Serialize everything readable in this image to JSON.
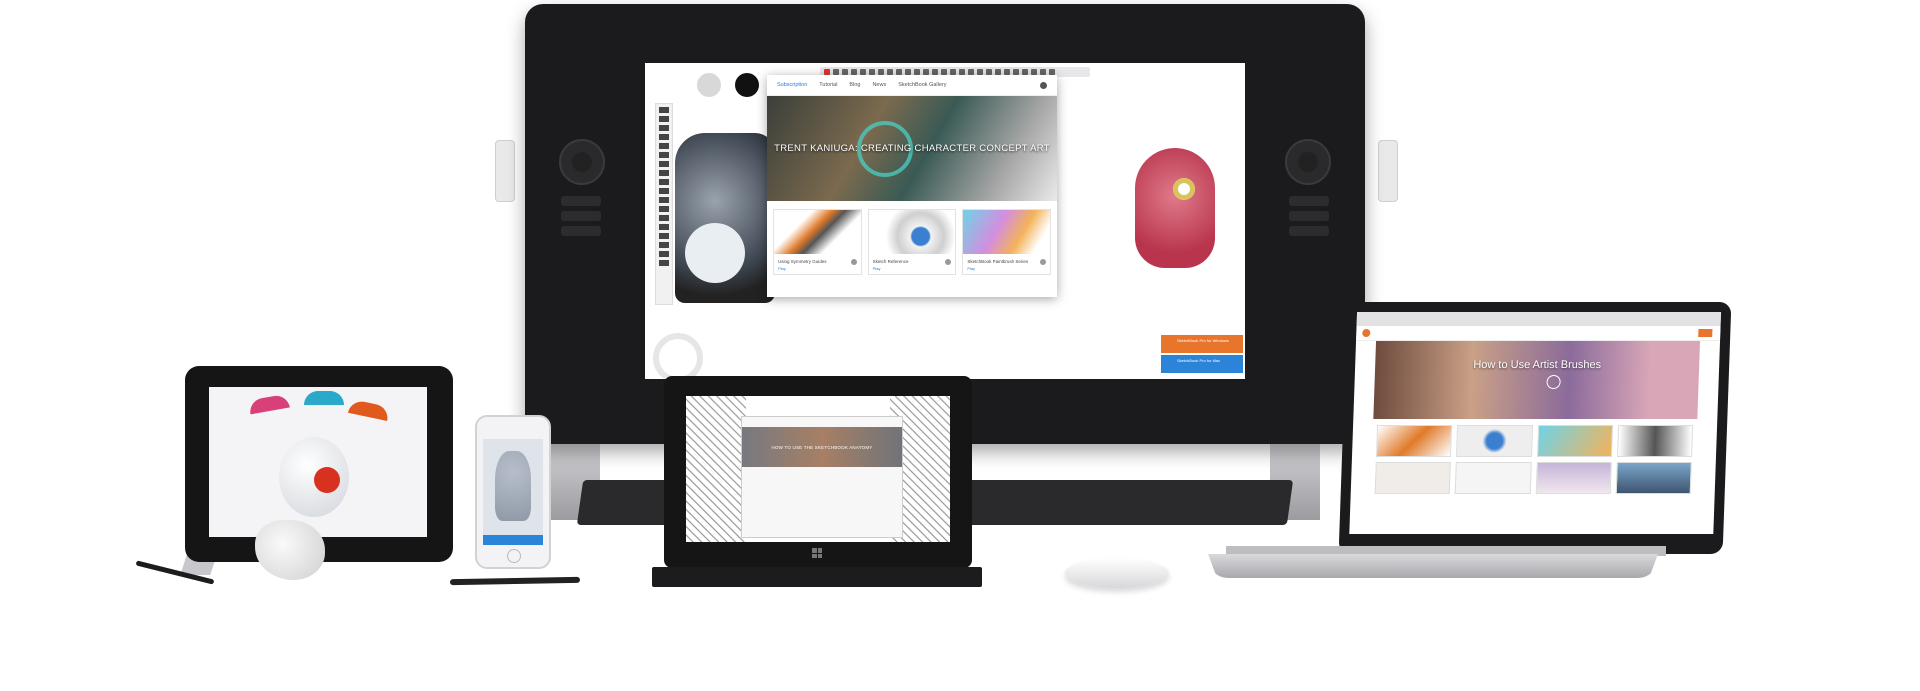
{
  "cintiq_screen": {
    "popup": {
      "nav": [
        "Subscription",
        "Tutorial",
        "Blog",
        "News",
        "SketchBook Gallery"
      ],
      "hero_title": "TRENT KANIUGA: CREATING CHARACTER CONCEPT ART",
      "cards": [
        {
          "label": "Using Symmetry Guides",
          "link": "Play"
        },
        {
          "label": "Sketch Reference",
          "link": "Play"
        },
        {
          "label": "SketchBook Paintbrush Series",
          "link": "Play"
        }
      ]
    },
    "toasts": [
      {
        "text": "SketchBook Pro for Windows",
        "color": "#e8752c"
      },
      {
        "text": "SketchBook Pro for Mac",
        "color": "#2b84d8"
      }
    ],
    "swatches": [
      "#d8d8d8",
      "#111111"
    ]
  },
  "center_tablet": {
    "title": "HOW TO USE THE SKETCHBOOK ANATOMY"
  },
  "laptop": {
    "hero_title": "How to Use Artist Brushes"
  },
  "colors": {
    "accent_orange": "#e8752c",
    "accent_blue": "#2b84d8",
    "device_black": "#1b1b1d"
  },
  "icons": [
    "dial-icon",
    "play-icon",
    "info-icon",
    "windows-logo-icon"
  ]
}
